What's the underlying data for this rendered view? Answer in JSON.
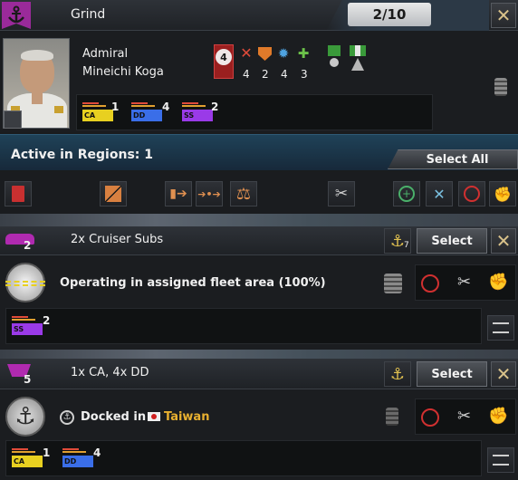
{
  "header": {
    "title": "Grind",
    "counter": "2/10",
    "close_glyph": "✕",
    "icon": "anchor-icon"
  },
  "admiral": {
    "rank": "Admiral",
    "name": "Mineichi Koga",
    "level": "4",
    "stats": [
      {
        "icon": "attack-icon",
        "value": "4",
        "color": "#e04b3a"
      },
      {
        "icon": "defense-icon",
        "value": "2",
        "color": "#e07a2a"
      },
      {
        "icon": "maneuver-icon",
        "value": "4",
        "color": "#4fa3e0"
      },
      {
        "icon": "coordination-icon",
        "value": "3",
        "color": "#6cc24a"
      }
    ],
    "ships": [
      {
        "type": "CA",
        "count": "1",
        "color": "#e8d020"
      },
      {
        "type": "DD",
        "count": "4",
        "color": "#3a6ee8"
      },
      {
        "type": "SS",
        "count": "2",
        "color": "#9a3ae8"
      }
    ]
  },
  "regions": {
    "label": "Active in Regions: 1",
    "select_all": "Select All"
  },
  "toolbar": {
    "icons": [
      "delete-icon",
      "split-icon",
      "detach-icon",
      "merge-icon",
      "balance-icon",
      "repair-icon",
      "add-icon",
      "patrol-icon",
      "no-mission-icon",
      "strike-icon"
    ]
  },
  "fleets": [
    {
      "count": "2",
      "title": "2x Cruiser Subs",
      "leader_level": "7",
      "select": "Select",
      "close_glyph": "✕",
      "status": "Operating in assigned fleet area (100%)",
      "ships": [
        {
          "type": "SS",
          "count": "2",
          "color": "#9a3ae8"
        }
      ],
      "badge_color": "#b02ab0"
    },
    {
      "count": "5",
      "title": "1x CA, 4x DD",
      "leader_level": "",
      "select": "Select",
      "close_glyph": "✕",
      "status_prefix": "Docked in",
      "status_place": "Taiwan",
      "ships": [
        {
          "type": "CA",
          "count": "1",
          "color": "#e8d020"
        },
        {
          "type": "DD",
          "count": "4",
          "color": "#3a6ee8"
        }
      ],
      "badge_color": "#b02ab0"
    }
  ]
}
